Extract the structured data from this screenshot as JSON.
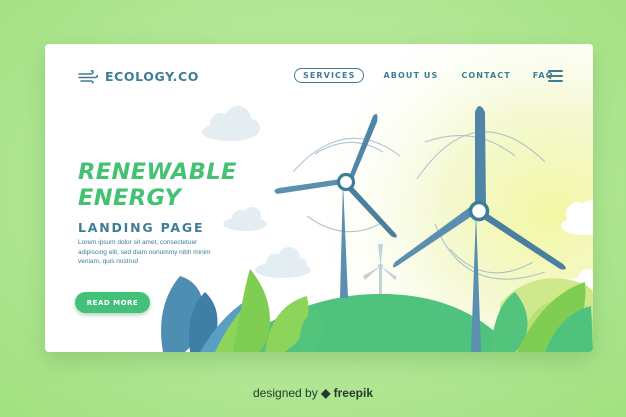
{
  "brand": {
    "name": "ECOLOGY.CO",
    "icon": "wind-icon"
  },
  "nav": {
    "items": [
      {
        "label": "SERVICES",
        "active": true
      },
      {
        "label": "ABOUT US",
        "active": false
      },
      {
        "label": "CONTACT",
        "active": false
      },
      {
        "label": "FAQ",
        "active": false
      }
    ],
    "menu_icon": "hamburger-menu-icon"
  },
  "hero": {
    "title_line1": "RENEWABLE",
    "title_line2": "ENERGY",
    "subtitle": "LANDING PAGE",
    "body_lines": [
      "Lorem ipsum dolor sit amet, consectetuer",
      "adipiscing elit, sed diam nonummy nibh  minim",
      "veniam, quis nostrud"
    ],
    "cta_label": "READ MORE"
  },
  "illustration": {
    "subject": "wind turbines on green hills",
    "icons": [
      "wind-turbine-icon",
      "cloud-icon",
      "leaf-icon"
    ]
  },
  "credit": {
    "prefix": "designed by ",
    "icon": "freepik-icon",
    "brand": "freepik"
  },
  "colors": {
    "accent_green": "#45c174",
    "nav_blue": "#3d7d96",
    "background": "#b6e89a",
    "hill_green": "#4fc27d",
    "turbine_blue": "#5a8fb0"
  }
}
